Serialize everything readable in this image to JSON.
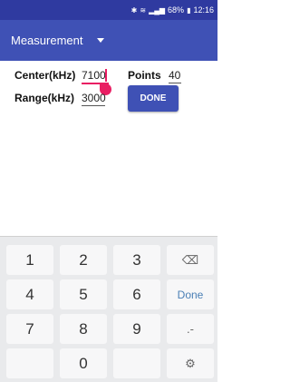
{
  "status": {
    "icons": [
      "bluetooth-icon",
      "vibrate-icon",
      "signal-icon",
      "battery-icon"
    ],
    "battery": "68%",
    "time": "12:16"
  },
  "app_bar": {
    "title": "Measurement",
    "dropdown_icon": "caret-down-icon"
  },
  "form": {
    "center_label": "Center(kHz)",
    "center_value": "7100",
    "points_label": "Points",
    "points_value": "40",
    "range_label": "Range(kHz)",
    "range_value": "3000",
    "done_label": "DONE"
  },
  "keyboard": {
    "keys": [
      "1",
      "2",
      "3",
      "4",
      "5",
      "6",
      "7",
      "8",
      "9",
      "0"
    ],
    "backspace_icon": "backspace-icon",
    "done_label": "Done",
    "punct_label": ".-",
    "settings_icon": "gear-icon"
  },
  "colors": {
    "status_bar": "#2f3aa0",
    "app_bar": "#3f51b5",
    "accent": "#e91e63",
    "button": "#3f51b5"
  }
}
